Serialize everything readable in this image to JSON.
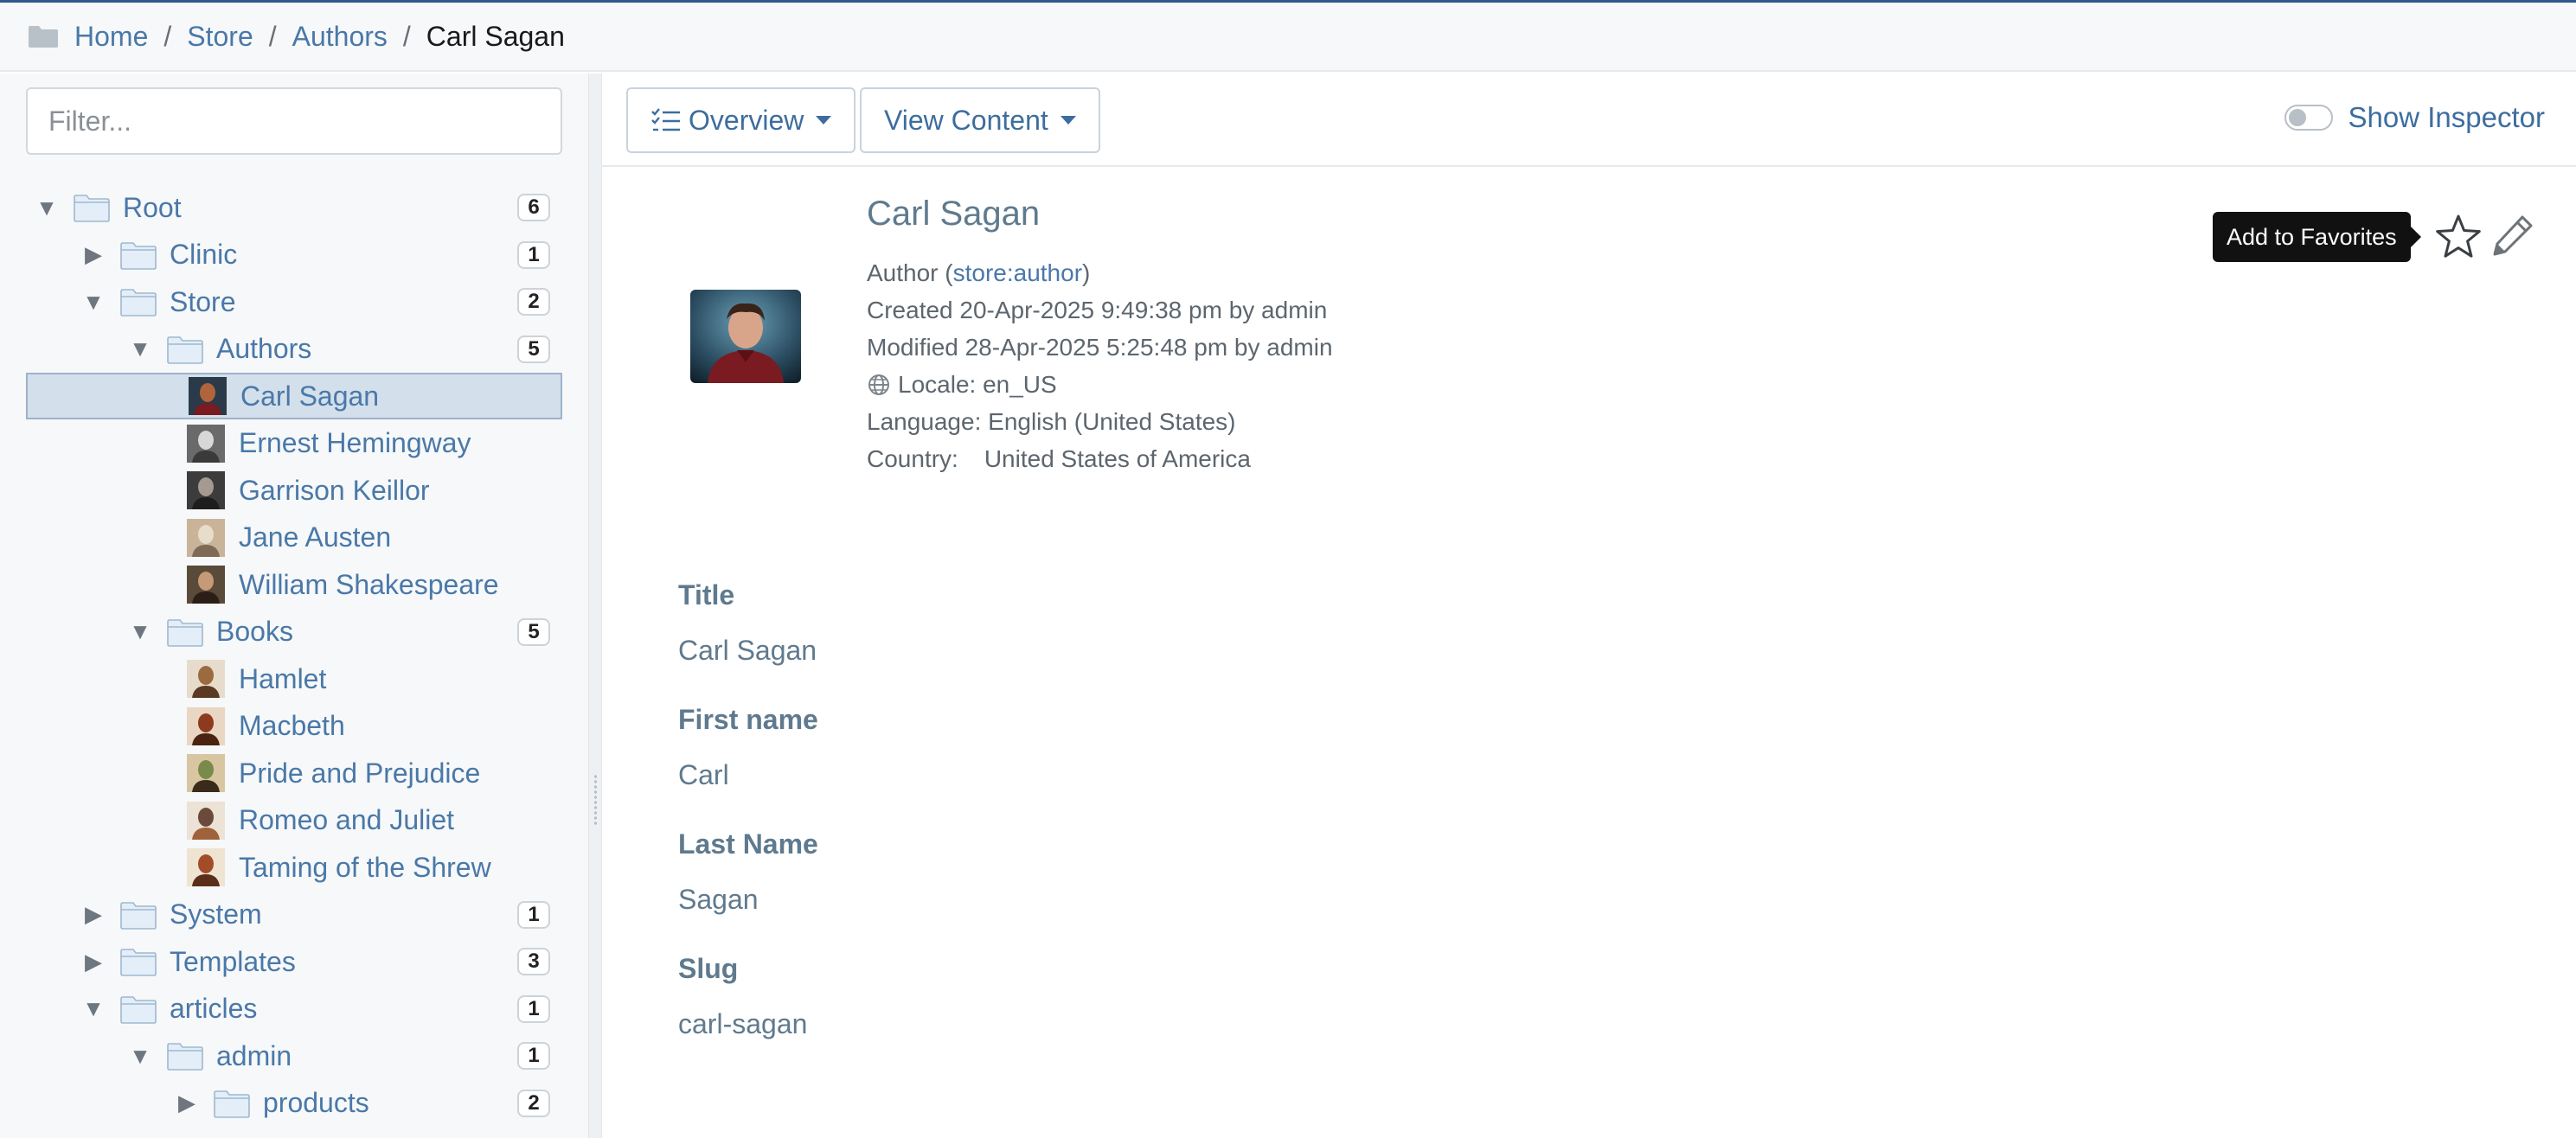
{
  "breadcrumb": {
    "items": [
      "Home",
      "Store",
      "Authors"
    ],
    "separator": "/",
    "current": "Carl Sagan"
  },
  "sidebar": {
    "filter_placeholder": "Filter...",
    "tree": [
      {
        "label": "Root",
        "count": "6",
        "toggle": "▼",
        "kind": "folder"
      },
      {
        "label": "Clinic",
        "count": "1",
        "toggle": "▶",
        "kind": "folder"
      },
      {
        "label": "Store",
        "count": "2",
        "toggle": "▼",
        "kind": "folder"
      },
      {
        "label": "Authors",
        "count": "5",
        "toggle": "▼",
        "kind": "folder"
      },
      {
        "label": "Carl Sagan",
        "kind": "image",
        "selected": true
      },
      {
        "label": "Ernest Hemingway",
        "kind": "image"
      },
      {
        "label": "Garrison Keillor",
        "kind": "image"
      },
      {
        "label": "Jane Austen",
        "kind": "image"
      },
      {
        "label": "William Shakespeare",
        "kind": "image"
      },
      {
        "label": "Books",
        "count": "5",
        "toggle": "▼",
        "kind": "folder"
      },
      {
        "label": "Hamlet",
        "kind": "image"
      },
      {
        "label": "Macbeth",
        "kind": "image"
      },
      {
        "label": "Pride and Prejudice",
        "kind": "image"
      },
      {
        "label": "Romeo and Juliet",
        "kind": "image"
      },
      {
        "label": "Taming of the Shrew",
        "kind": "image"
      },
      {
        "label": "System",
        "count": "1",
        "toggle": "▶",
        "kind": "folder"
      },
      {
        "label": "Templates",
        "count": "3",
        "toggle": "▶",
        "kind": "folder"
      },
      {
        "label": "articles",
        "count": "1",
        "toggle": "▼",
        "kind": "folder"
      },
      {
        "label": "admin",
        "count": "1",
        "toggle": "▼",
        "kind": "folder"
      },
      {
        "label": "products",
        "count": "2",
        "toggle": "▶",
        "kind": "folder"
      }
    ]
  },
  "toolbar": {
    "overview_label": "Overview",
    "view_content_label": "View Content",
    "inspector_label": "Show Inspector"
  },
  "content": {
    "title": "Carl Sagan",
    "type_prefix": "Author (",
    "type_link": "store:author",
    "type_suffix": ")",
    "created": "Created 20-Apr-2025 9:49:38 pm by admin",
    "modified": "Modified 28-Apr-2025 5:25:48 pm by admin",
    "locale": "Locale: en_US",
    "language": "Language: English (United States)",
    "country_label": "Country:",
    "country_value": "United States of America",
    "favorites_tooltip": "Add to Favorites",
    "fields": [
      {
        "label": "Title",
        "value": "Carl Sagan"
      },
      {
        "label": "First name",
        "value": "Carl"
      },
      {
        "label": "Last Name",
        "value": "Sagan"
      },
      {
        "label": "Slug",
        "value": "carl-sagan"
      }
    ]
  },
  "icons": {
    "breadcrumb": "folder-icon",
    "tree_folder": "folder-icon",
    "overview": "checklist-icon",
    "locale": "globe-icon",
    "favorite": "star-icon",
    "edit": "pencil-icon"
  },
  "colors": {
    "link": "#4a78a8",
    "selected_row": "#d3dfea",
    "sidebar_bg": "#f6f8f9",
    "heading": "#5f7a8e",
    "tooltip_bg": "#111111"
  }
}
